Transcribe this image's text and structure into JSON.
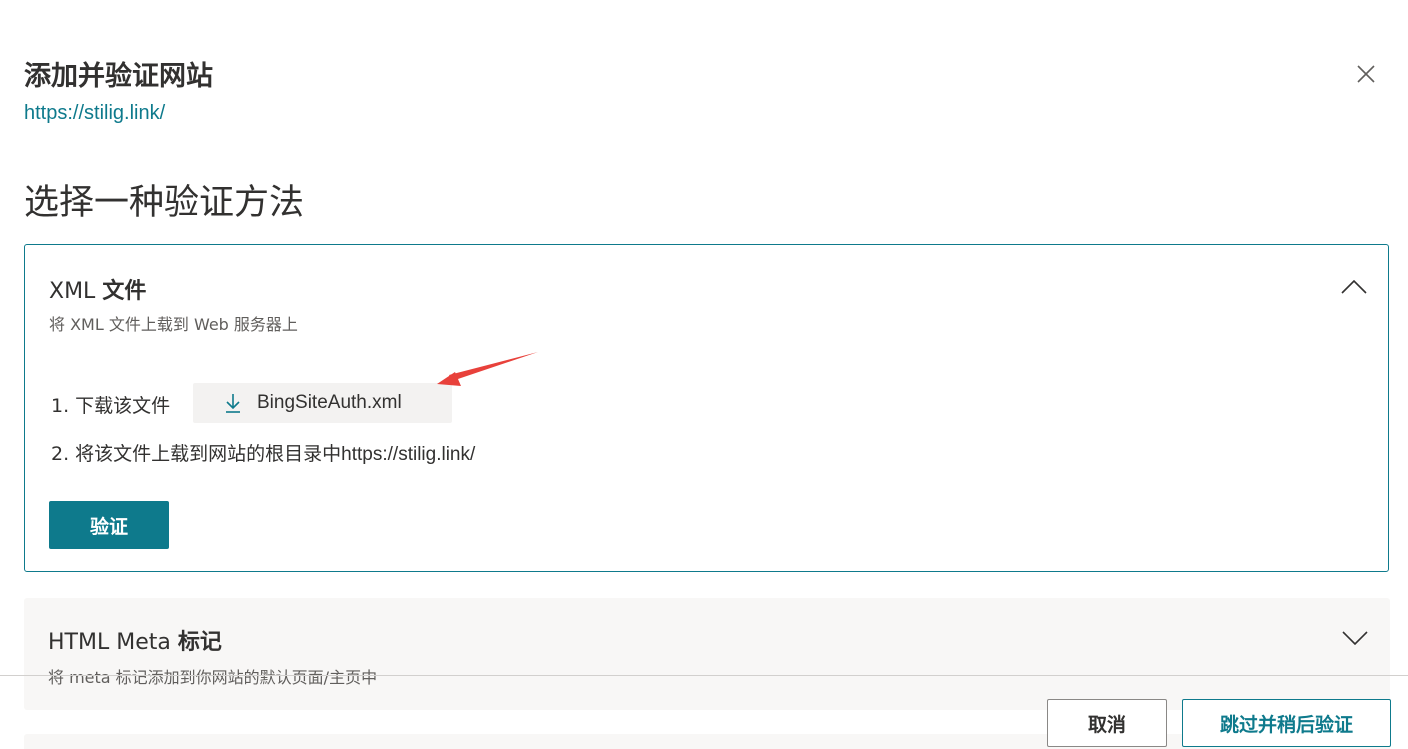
{
  "dialog": {
    "title": "添加并验证网站",
    "site_url": "https://stilig.link/"
  },
  "section_heading": "选择一种验证方法",
  "methods": [
    {
      "title_prefix": "XML",
      "title_bold": "文件",
      "subtitle": "将 XML 文件上载到 Web 服务器上",
      "expanded": true,
      "step1_label": "1. 下载该文件",
      "download_file": "BingSiteAuth.xml",
      "step2_label": "2. 将该文件上载到网站的根目录中",
      "step2_url": "https://stilig.link/",
      "verify_label": "验证"
    },
    {
      "title_prefix": "HTML Meta",
      "title_bold": "标记",
      "subtitle": "将 meta 标记添加到你网站的默认页面/主页中",
      "expanded": false
    }
  ],
  "footer": {
    "cancel_label": "取消",
    "skip_label": "跳过并稍后验证"
  },
  "colors": {
    "accent": "#0e7a8c",
    "annotation_arrow": "#e8413b"
  },
  "icons": {
    "close": "close-icon",
    "collapse": "chevron-up-icon",
    "expand": "chevron-down-icon",
    "download": "download-icon"
  }
}
